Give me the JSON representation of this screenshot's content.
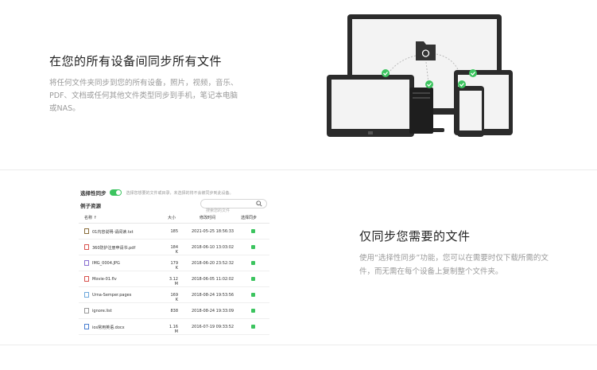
{
  "section1": {
    "title": "在您的所有设备间同步所有文件",
    "desc": "将任何文件夹同步到您的所有设备，照片，视频，音乐、PDF、文档或任何其他文件类型同步到手机，笔记本电脑或NAS。"
  },
  "section2": {
    "title": "仅同步您需要的文件",
    "desc": "使用“选择性同步”功能，您可以在需要时仅下载所需的文件，而无需在每个设备上复制整个文件夹。"
  },
  "panel": {
    "selective_label": "选择性同步",
    "selective_hint": "选择您想要的文件或目录，未选择的将不会被同步到此设备。",
    "resource_label": "例子资源",
    "search_placeholder": "搜索您的文件",
    "headers": {
      "name": "名称 ↑",
      "size": "大小",
      "time": "修改时间",
      "sync": "选择同步"
    },
    "rows": [
      {
        "name": "01内容说明-请阅读.txt",
        "size": "185",
        "time": "2021-05-25 18:56:33",
        "color": "#8a6d3b"
      },
      {
        "name": "360防护注册申请书.pdf",
        "size": "184 K",
        "time": "2018-06-10 13:03:02",
        "color": "#d9534f"
      },
      {
        "name": "IMG_0004.JPG",
        "size": "179 K",
        "time": "2018-06-20 23:52:32",
        "color": "#8a6fd1"
      },
      {
        "name": "Movie-01.flv",
        "size": "3.12 M",
        "time": "2018-06-05 11:02:02",
        "color": "#d9534f"
      },
      {
        "name": "Urna-Semper.pages",
        "size": "169 K",
        "time": "2018-08-24 19:53:56",
        "color": "#6fa8dc"
      },
      {
        "name": "ignore.list",
        "size": "838",
        "time": "2018-08-24 19:33:09",
        "color": "#999999"
      },
      {
        "name": "ios常用英语.docx",
        "size": "1.16 M",
        "time": "2016-07-19 09:33:52",
        "color": "#4a7fd1"
      }
    ]
  }
}
